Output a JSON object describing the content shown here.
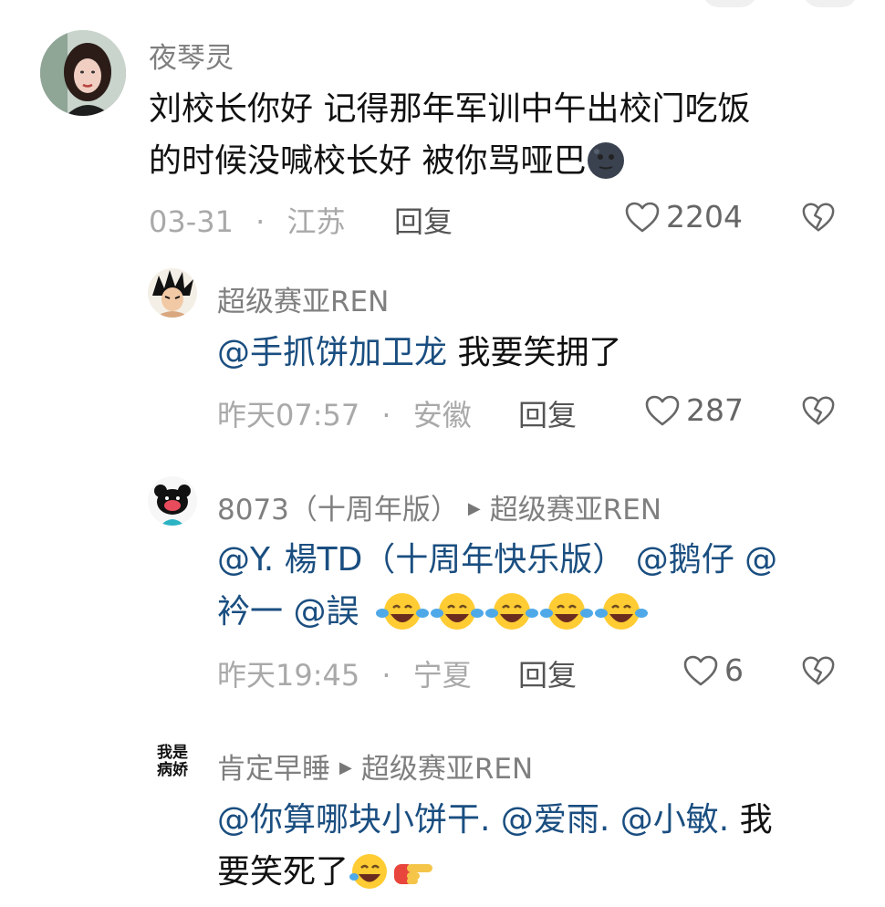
{
  "comments": [
    {
      "username": "夜琴灵",
      "text": "刘校长你好 记得那年军训中午出校门吃饭的时候没喊校长好 被你骂哑巴",
      "line1": "刘校长你好 记得那年军训中午出校门吃饭",
      "line2": "的时候没喊校长好 被你骂哑巴",
      "date": "03-31",
      "location": "江苏",
      "reply_label": "回复",
      "likes": "2204"
    },
    {
      "username": "超级赛亚REN",
      "mention": "@手抓饼加卫龙",
      "text": " 我要笑拥了",
      "date": "昨天07:57",
      "location": "安徽",
      "reply_label": "回复",
      "likes": "287"
    },
    {
      "username": "8073（十周年版）",
      "reply_to": "超级赛亚REN",
      "line1_mentions": "@Y. 楊TD（十周年快乐版） @鹅仔 @",
      "line2_mentions": "衿一 @誤",
      "date": "昨天19:45",
      "location": "宁夏",
      "reply_label": "回复",
      "likes": "6"
    },
    {
      "username": "肯定早睡",
      "reply_to": "超级赛亚REN",
      "avatar_text": "我是病娇",
      "line1_mentions": "@你算哪块小饼干. @爱雨. @小敏.",
      "line1_text": " 我",
      "line2_text": "要笑死了"
    }
  ],
  "separator": "·",
  "icons": {
    "like": "heart-outline-icon",
    "dislike": "broken-heart-icon",
    "reply_arrow": "triangle-right-icon",
    "emoji_moon": "new-moon-face-emoji",
    "emoji_laugh": "tears-of-joy-emoji",
    "emoji_point": "pointing-right-hand-emoji"
  },
  "colors": {
    "mention": "#1a4e80",
    "username": "#7f7f7f",
    "meta": "#a9a9a9"
  }
}
